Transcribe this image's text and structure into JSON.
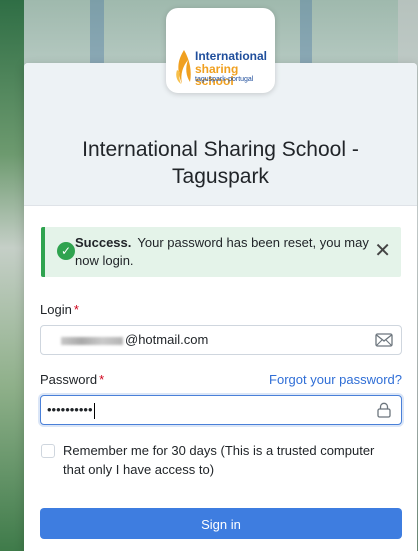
{
  "logo": {
    "line1": "International",
    "line2": "sharing school",
    "line3": "taguspark-portugal"
  },
  "page": {
    "title": "International Sharing School - Taguspark"
  },
  "alert": {
    "strong": "Success.",
    "message": "Your password has been reset, you may now login.",
    "close_symbol": "✕"
  },
  "login": {
    "label": "Login",
    "required_mark": "*",
    "value_suffix": "@hotmail.com",
    "icon": "envelope-icon"
  },
  "password": {
    "label": "Password",
    "required_mark": "*",
    "forgot_link": "Forgot your password?",
    "masked_value": "••••••••••",
    "icon": "lock-icon"
  },
  "remember": {
    "label": "Remember me for 30 days (This is a trusted computer that only I have access to)",
    "checked": false
  },
  "signin": {
    "label": "Sign in"
  },
  "colors": {
    "accent": "#3e7de0",
    "success": "#2fa34f",
    "link": "#2f6ed6",
    "required": "#d0021b"
  }
}
